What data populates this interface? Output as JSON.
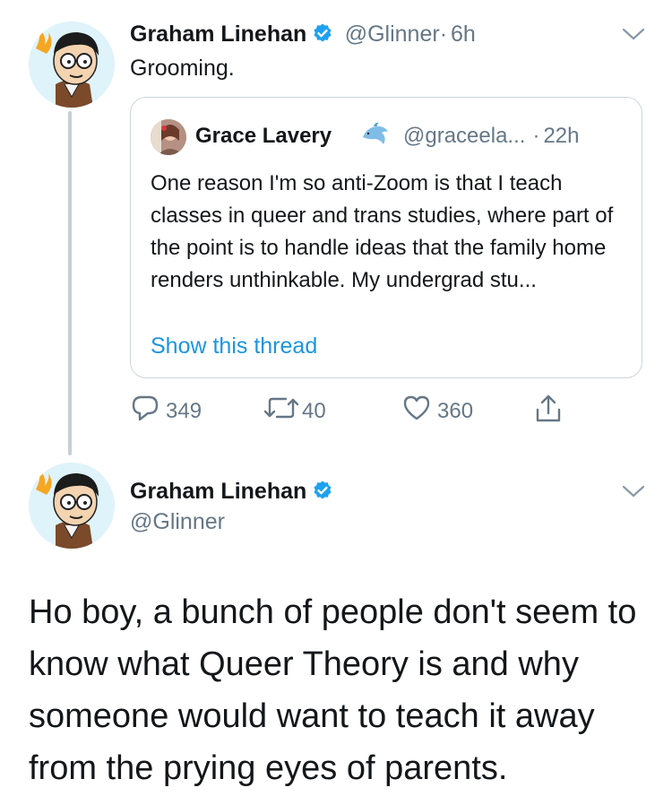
{
  "tweet1": {
    "author_name": "Graham Linehan",
    "handle": "@Glinner",
    "separator": "·",
    "time": "6h",
    "text": "Grooming.",
    "quote": {
      "author_name": "Grace Lavery",
      "handle": "@graceela...",
      "separator": "·",
      "time": "22h",
      "text": "One reason I'm so anti-Zoom is that I teach classes in queer and trans studies, where part of the point is to handle ideas that the family home renders unthinkable. My undergrad stu...",
      "link": "Show this thread"
    },
    "actions": {
      "replies": "349",
      "retweets": "40",
      "likes": "360"
    }
  },
  "tweet2": {
    "author_name": "Graham Linehan",
    "handle": "@Glinner",
    "text": "Ho boy, a bunch of people don't seem to know what Queer Theory is and why someone would want to teach it away from the prying eyes of parents."
  },
  "icons": {
    "verified": "verified-badge-icon",
    "chevron": "chevron-down-icon",
    "reply": "reply-icon",
    "retweet": "retweet-icon",
    "like": "heart-icon",
    "share": "share-icon",
    "emoji": "dolphin-emoji-icon"
  },
  "colors": {
    "text": "#14171a",
    "secondary": "#657786",
    "link": "#1b95e0",
    "verified": "#1da1f2",
    "border": "#ccd6dd"
  }
}
